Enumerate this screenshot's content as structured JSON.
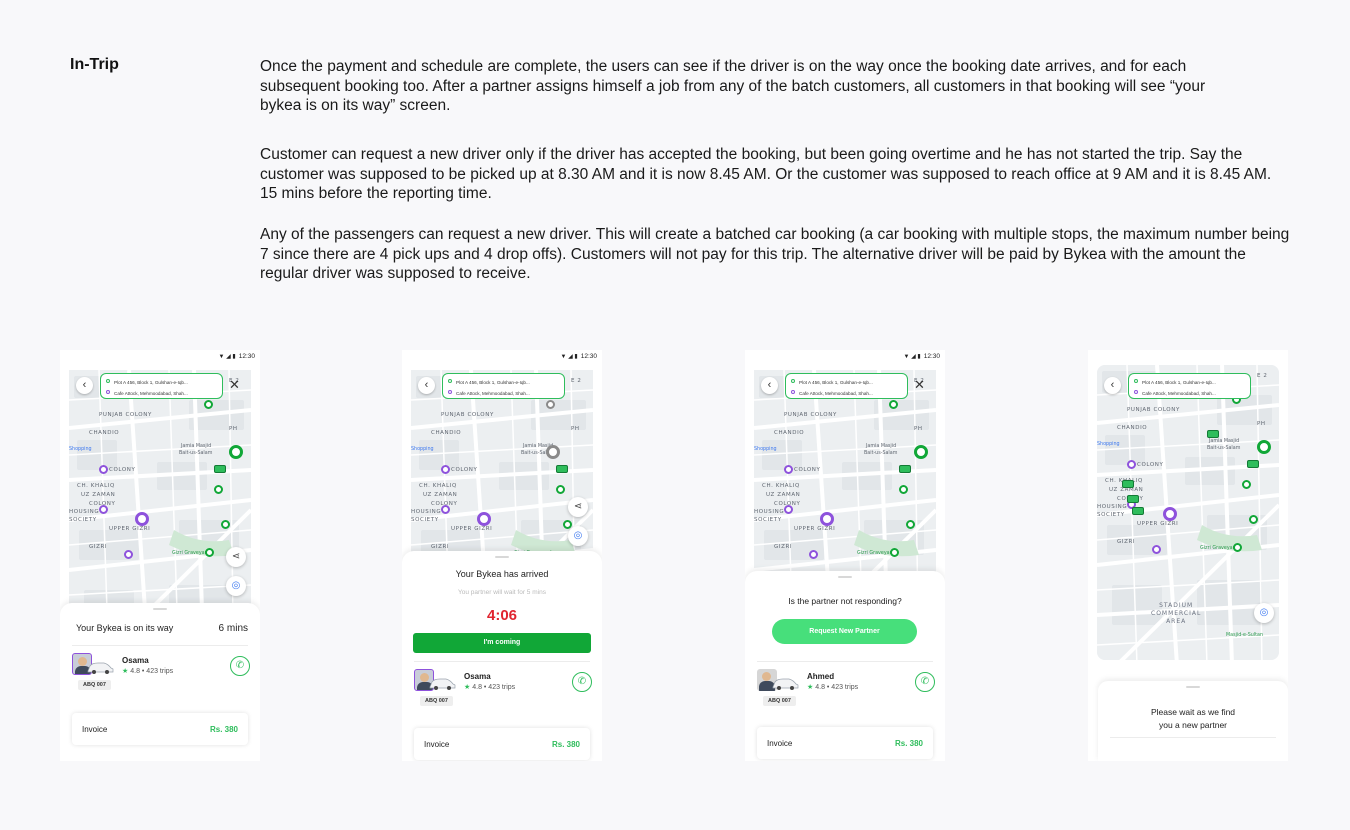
{
  "section": {
    "title": "In-Trip",
    "paragraphs": [
      "Once the payment and schedule are complete, the users can see if the driver is on the way once the booking date arrives, and for each subsequent booking too. After a partner assigns himself a job from any of the batch customers, all customers in that booking will see “your bykea is on its way” screen.",
      "Customer can request a new driver only if the driver has accepted the booking, but been going overtime and he has not started the trip. Say the customer was supposed to be picked up at 8.30 AM and it is now 8.45 AM. Or the customer was supposed to reach office at 9 AM and it is 8.45 AM. 15 mins before the reporting time.",
      "Any of the passengers can request a new driver. This will create a batched car booking (a car booking with multiple stops, the maximum number being 7 since there are 4 pick ups and 4 drop offs). Customers will not pay for this trip. The alternative driver will be paid by Bykea with the amount the regular driver was supposed to receive."
    ]
  },
  "common": {
    "status_time": "12:30",
    "pickup_address": "Plot A 456, Block 1, Gulshan-e-Iqb...",
    "dropoff_address": "Cafe Attock, Mehmoodabad, Shah...",
    "map_labels": [
      "PUNJAB COLONY",
      "CHANDIO",
      "COLONY",
      "CH. KHALIQ",
      "UZ ZAMAN",
      "COLONY",
      "HOUSING",
      "SOCIETY",
      "UPPER GIZRI",
      "GIZRI",
      "Gizri Graveyard",
      "Jamia Masjid",
      "Bait-us-Salam",
      "Shopping",
      "PH",
      "E 2"
    ],
    "invoice_label": "Invoice",
    "invoice_amount": "Rs. 380",
    "plate": "ABQ 007",
    "rating": "4.8 • 423 trips"
  },
  "screen1": {
    "title": "Your Bykea is on its way",
    "eta": "6 mins",
    "driver": "Osama"
  },
  "screen2": {
    "title": "Your Bykea has arrived",
    "subtitle": "You partner will wait for 5 mins",
    "timer": "4:06",
    "button": "I'm coming",
    "driver": "Osama"
  },
  "screen3": {
    "title": "Is the partner not responding?",
    "button": "Request New Partner",
    "driver": "Ahmed"
  },
  "screen4": {
    "title_line1": "Please wait as we find",
    "title_line2": "you a new partner",
    "map_extra": [
      "STADIUM",
      "COMMERCIAL",
      "AREA",
      "Masjid-e-Sultan"
    ]
  },
  "colors": {
    "brand_green": "#2fbd5c",
    "button_green": "#11a737",
    "light_green": "#47df7b",
    "purple": "#8e52dc",
    "timer_red": "#e0242f"
  }
}
